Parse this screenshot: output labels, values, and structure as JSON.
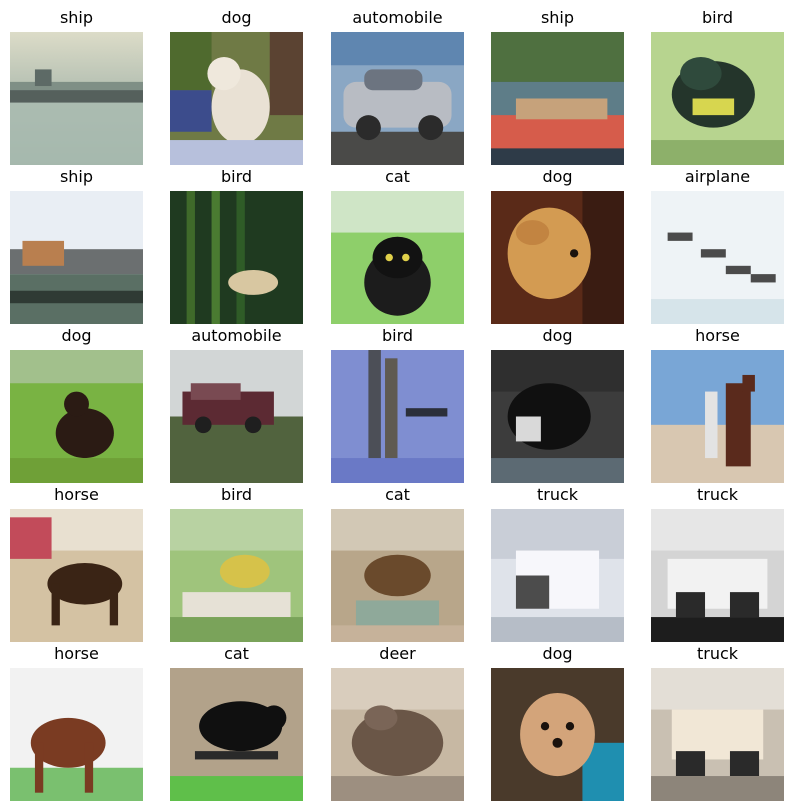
{
  "images": [
    {
      "label": "ship"
    },
    {
      "label": "dog"
    },
    {
      "label": "automobile"
    },
    {
      "label": "ship"
    },
    {
      "label": "bird"
    },
    {
      "label": "ship"
    },
    {
      "label": "bird"
    },
    {
      "label": "cat"
    },
    {
      "label": "dog"
    },
    {
      "label": "airplane"
    },
    {
      "label": "dog"
    },
    {
      "label": "automobile"
    },
    {
      "label": "bird"
    },
    {
      "label": "dog"
    },
    {
      "label": "horse"
    },
    {
      "label": "horse"
    },
    {
      "label": "bird"
    },
    {
      "label": "cat"
    },
    {
      "label": "truck"
    },
    {
      "label": "truck"
    },
    {
      "label": "horse"
    },
    {
      "label": "cat"
    },
    {
      "label": "deer"
    },
    {
      "label": "dog"
    },
    {
      "label": "truck"
    }
  ]
}
